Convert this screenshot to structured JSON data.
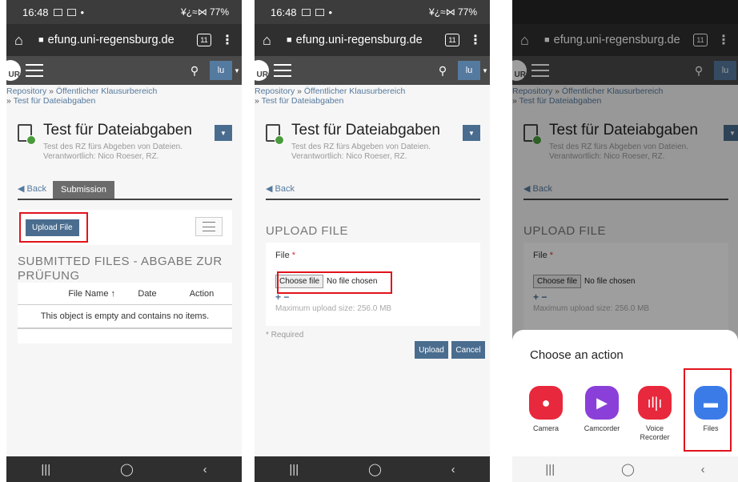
{
  "status": {
    "time": "16:48",
    "icons_right": "¥¿≈⋈ 77%"
  },
  "browser": {
    "url": "efung.uni-regensburg.de",
    "tab_count": "11"
  },
  "nav": {
    "user": "lu",
    "logo": "UR"
  },
  "breadcrumb": {
    "part1": "Repository",
    "sep": "»",
    "part2": "Öffentlicher Klausurbereich",
    "part3": "Test für Dateiabgaben"
  },
  "page": {
    "title": "Test für Dateiabgaben",
    "desc1": "Test des RZ fürs Abgeben von Dateien.",
    "desc2": "Verantwortlich: Nico Roeser, RZ.",
    "back": "Back",
    "submission_tab": "Submission"
  },
  "screen1": {
    "upload_button": "Upload File",
    "section_title": "SUBMITTED FILES - ABGABE ZUR PRÜFUNG",
    "columns": [
      "File Name ↑",
      "Date",
      "Action"
    ],
    "empty": "This object is empty and contains no items."
  },
  "screen2": {
    "section_title": "UPLOAD FILE",
    "file_label": "File",
    "required_star": "*",
    "choose_button": "Choose file",
    "no_file": "No file chosen",
    "plusminus": "+ −",
    "max_size": "Maximum upload size: 256.0 MB",
    "required_note": "* Required",
    "upload": "Upload",
    "cancel": "Cancel"
  },
  "screen3": {
    "sheet_title": "Choose an action",
    "apps": [
      {
        "label": "Camera",
        "icon": "camera-icon",
        "color": "#e8283c"
      },
      {
        "label": "Camcorder",
        "icon": "camcorder-icon",
        "color": "#8b3fd9"
      },
      {
        "label": "Voice Recorder",
        "icon": "voice-recorder-icon",
        "color": "#e8283c"
      },
      {
        "label": "Files",
        "icon": "folder-icon",
        "color": "#3b7be8"
      }
    ]
  },
  "nav_buttons": {
    "recent": "|||",
    "home": "◯",
    "back": "‹"
  },
  "colors": {
    "accent": "#4a6d8f",
    "highlight": "#e0141c",
    "topbar": "#2f2f2f"
  }
}
